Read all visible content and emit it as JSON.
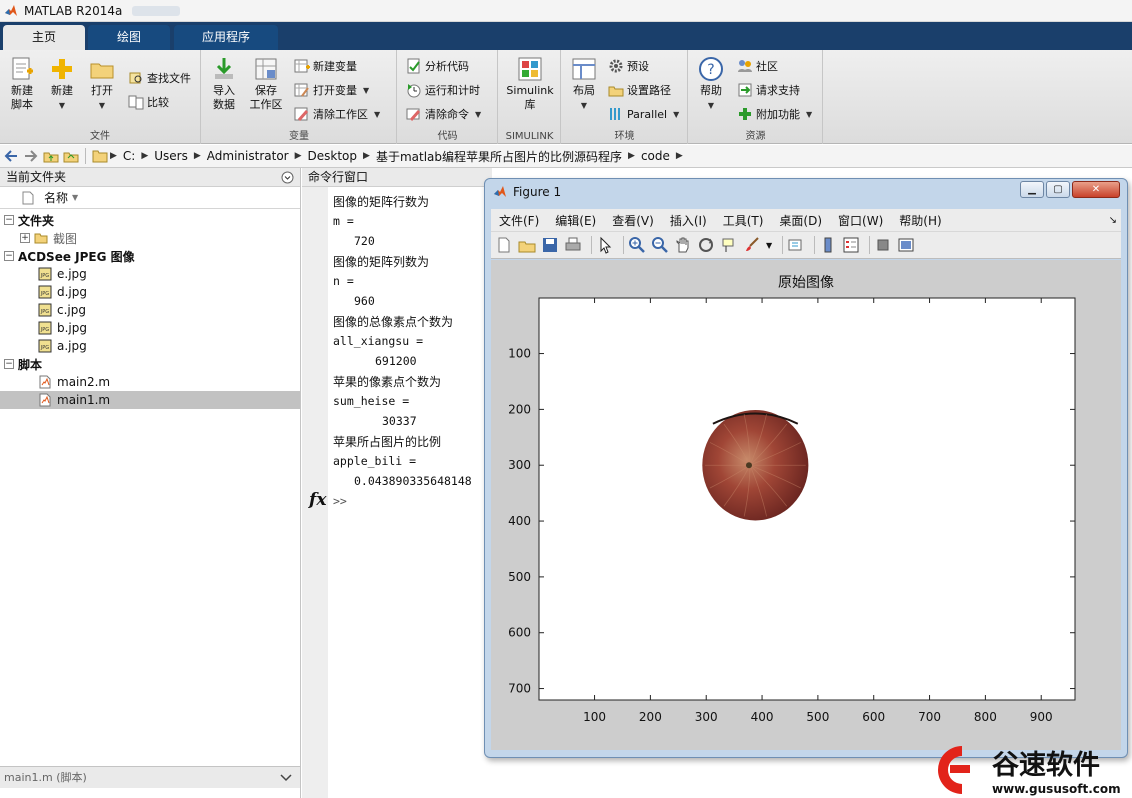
{
  "app": {
    "title": "MATLAB R2014a"
  },
  "tabs": [
    {
      "label": "主页"
    },
    {
      "label": "绘图"
    },
    {
      "label": "应用程序"
    }
  ],
  "ribbon": {
    "file": {
      "new_script": "新建\n脚本",
      "new": "新建",
      "open": "打开",
      "find_files": "查找文件",
      "compare": "比较",
      "label": "文件"
    },
    "variable": {
      "import": "导入\n数据",
      "save_ws": "保存\n工作区",
      "new_var": "新建变量",
      "open_var": "打开变量",
      "clear_ws": "清除工作区",
      "label": "变量"
    },
    "code": {
      "analyze": "分析代码",
      "run_time": "运行和计时",
      "clear_cmd": "清除命令",
      "label": "代码"
    },
    "simulink": {
      "lib": "Simulink\n库",
      "label": "SIMULINK"
    },
    "env": {
      "layout": "布局",
      "prefs": "预设",
      "set_path": "设置路径",
      "parallel": "Parallel",
      "label": "环境"
    },
    "res": {
      "help": "帮助",
      "community": "社区",
      "support": "请求支持",
      "addons": "附加功能",
      "label": "资源"
    }
  },
  "address": {
    "segments": [
      "C:",
      "Users",
      "Administrator",
      "Desktop",
      "基于matlab编程苹果所占图片的比例源码程序",
      "code"
    ]
  },
  "current_folder": {
    "title": "当前文件夹",
    "col_name": "名称",
    "groups": [
      {
        "label": "文件夹",
        "items": [
          {
            "name": "截图"
          }
        ]
      },
      {
        "label": "ACDSee JPEG 图像",
        "items": [
          {
            "name": "e.jpg"
          },
          {
            "name": "d.jpg"
          },
          {
            "name": "c.jpg"
          },
          {
            "name": "b.jpg"
          },
          {
            "name": "a.jpg"
          }
        ]
      },
      {
        "label": "脚本",
        "items": [
          {
            "name": "main2.m"
          },
          {
            "name": "main1.m"
          }
        ]
      }
    ],
    "details": "main1.m (脚本)"
  },
  "command": {
    "title": "命令行窗口",
    "lines": [
      "图像的矩阵行数为",
      "m =",
      "720",
      "图像的矩阵列数为",
      "n =",
      "960",
      "图像的总像素点个数为",
      "all_xiangsu =",
      "691200",
      "苹果的像素点个数为",
      "sum_heise =",
      "30337",
      "苹果所占图片的比例",
      "apple_bili =",
      "0.043890335648148"
    ],
    "fx": "fx",
    "prompt": ">>"
  },
  "figure": {
    "title": "Figure 1",
    "menu": [
      "文件(F)",
      "编辑(E)",
      "查看(V)",
      "插入(I)",
      "工具(T)",
      "桌面(D)",
      "窗口(W)",
      "帮助(H)"
    ]
  },
  "chart_data": {
    "type": "image",
    "title": "原始图像",
    "xlim": [
      0.5,
      960.5
    ],
    "ylim": [
      0.5,
      720.5
    ],
    "y_reversed": true,
    "xticks": [
      100,
      200,
      300,
      400,
      500,
      600,
      700,
      800,
      900
    ],
    "yticks": [
      100,
      200,
      300,
      400,
      500,
      600,
      700
    ],
    "content": {
      "kind": "apple",
      "center": [
        388,
        300
      ],
      "radius_x": 95,
      "radius_y": 99
    }
  },
  "watermark": {
    "brand": "谷速软件",
    "url": "www.gususoft.com"
  },
  "colors": {
    "tabbar": "#1a3f6b",
    "selection": "#c2c2c2",
    "apple": "#8a2f2a"
  }
}
